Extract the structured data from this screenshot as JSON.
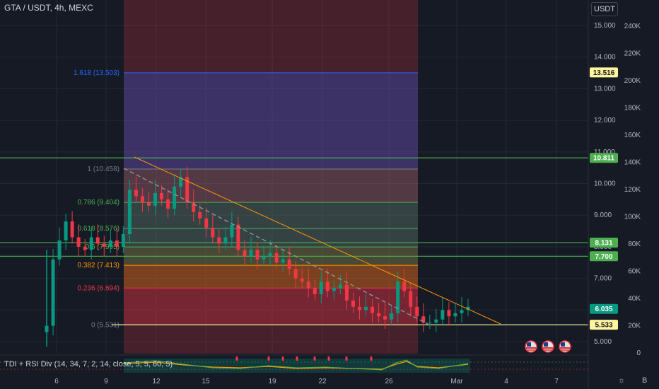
{
  "header": {
    "symbol_title": "GTA / USDT, 4h, MEXC",
    "currency": "USDT"
  },
  "indicator": {
    "label": "TDI + RSI Div (14, 34, 7, 2, 14, close, 5, 5, 60, 5)"
  },
  "price_axis": {
    "ticks": [
      "15.000",
      "14.000",
      "13.000",
      "12.000",
      "11.000",
      "10.000",
      "9.000",
      "8.000",
      "7.000",
      "6.000",
      "5.000"
    ],
    "tick_values": [
      15,
      14,
      13,
      12,
      11,
      10,
      9,
      8,
      7,
      6,
      5
    ]
  },
  "volume_axis": {
    "ticks": [
      "240K",
      "220K",
      "200K",
      "180K",
      "160K",
      "140K",
      "120K",
      "100K",
      "80K",
      "60K",
      "40K",
      "20K",
      "0"
    ]
  },
  "time_axis": {
    "ticks": [
      "6",
      "9",
      "12",
      "15",
      "19",
      "22",
      "26",
      "Mar",
      "4",
      "7"
    ]
  },
  "price_tags": [
    {
      "label": "13.516",
      "value": 13.516,
      "bg": "#fff59d",
      "fg": "#131722"
    },
    {
      "label": "10.811",
      "value": 10.811,
      "bg": "#4caf50",
      "fg": "#ffffff"
    },
    {
      "label": "8.131",
      "value": 8.131,
      "bg": "#4caf50",
      "fg": "#ffffff"
    },
    {
      "label": "7.700",
      "value": 7.7,
      "bg": "#4caf50",
      "fg": "#ffffff"
    },
    {
      "label": "6.035",
      "value": 6.035,
      "bg": "#089981",
      "fg": "#ffffff"
    },
    {
      "label": "5.533",
      "value": 5.533,
      "bg": "#fff59d",
      "fg": "#131722"
    }
  ],
  "fib_levels": [
    {
      "label": "1.618 (13.503)",
      "value": 13.503,
      "color": "#2962ff"
    },
    {
      "label": "1 (10.458)",
      "value": 10.458,
      "color": "#787b86"
    },
    {
      "label": "0.786 (9.404)",
      "value": 9.404,
      "color": "#4caf50"
    },
    {
      "label": "0.618 (8.576)",
      "value": 8.576,
      "color": "#4caf50"
    },
    {
      "label": "0.5 (7.995)",
      "value": 7.995,
      "color": "#4caf50"
    },
    {
      "label": "0.382 (7.413)",
      "value": 7.413,
      "color": "#ff9800"
    },
    {
      "label": "0.236 (6.694)",
      "value": 6.694,
      "color": "#f23645"
    },
    {
      "label": "0 (5.531)",
      "value": 5.531,
      "color": "#787b86"
    }
  ],
  "horizontal_lines": [
    {
      "value": 10.811,
      "color": "#4caf50"
    },
    {
      "value": 8.131,
      "color": "#4caf50"
    },
    {
      "value": 7.7,
      "color": "#4caf50"
    },
    {
      "value": 5.533,
      "color": "#fff59d"
    }
  ],
  "colors": {
    "background": "#161a25",
    "up": "#089981",
    "down": "#f23645",
    "grid": "#242833",
    "trendline": "#ff9800"
  },
  "chart_data": {
    "type": "candlestick",
    "title": "GTA / USDT, 4h, MEXC",
    "ylim": [
      4.6,
      15.7
    ],
    "x_ticks": [
      "6",
      "9",
      "12",
      "15",
      "19",
      "22",
      "26",
      "Mar",
      "4",
      "7"
    ],
    "series": [
      {
        "name": "close",
        "values": [
          5.5,
          7.6,
          8.2,
          8.8,
          8.3,
          8.0,
          7.9,
          8.3,
          8.1,
          8.0,
          8.2,
          8.0,
          8.4,
          9.8,
          9.6,
          9.4,
          9.3,
          9.7,
          9.5,
          9.2,
          9.9,
          10.2,
          9.4,
          9.1,
          8.9,
          8.6,
          8.3,
          8.1,
          8.3,
          8.7,
          7.9,
          7.7,
          7.9,
          7.6,
          7.7,
          7.8,
          7.5,
          7.6,
          7.3,
          7.0,
          6.9,
          6.7,
          6.5,
          6.9,
          6.6,
          6.7,
          6.8,
          6.3,
          6.1,
          6.0,
          6.1,
          5.9,
          5.8,
          5.7,
          5.9,
          6.9,
          6.6,
          6.1,
          5.8,
          5.6,
          5.6,
          5.7,
          6.0,
          5.8,
          5.9,
          6.0,
          6.1
        ]
      }
    ]
  }
}
